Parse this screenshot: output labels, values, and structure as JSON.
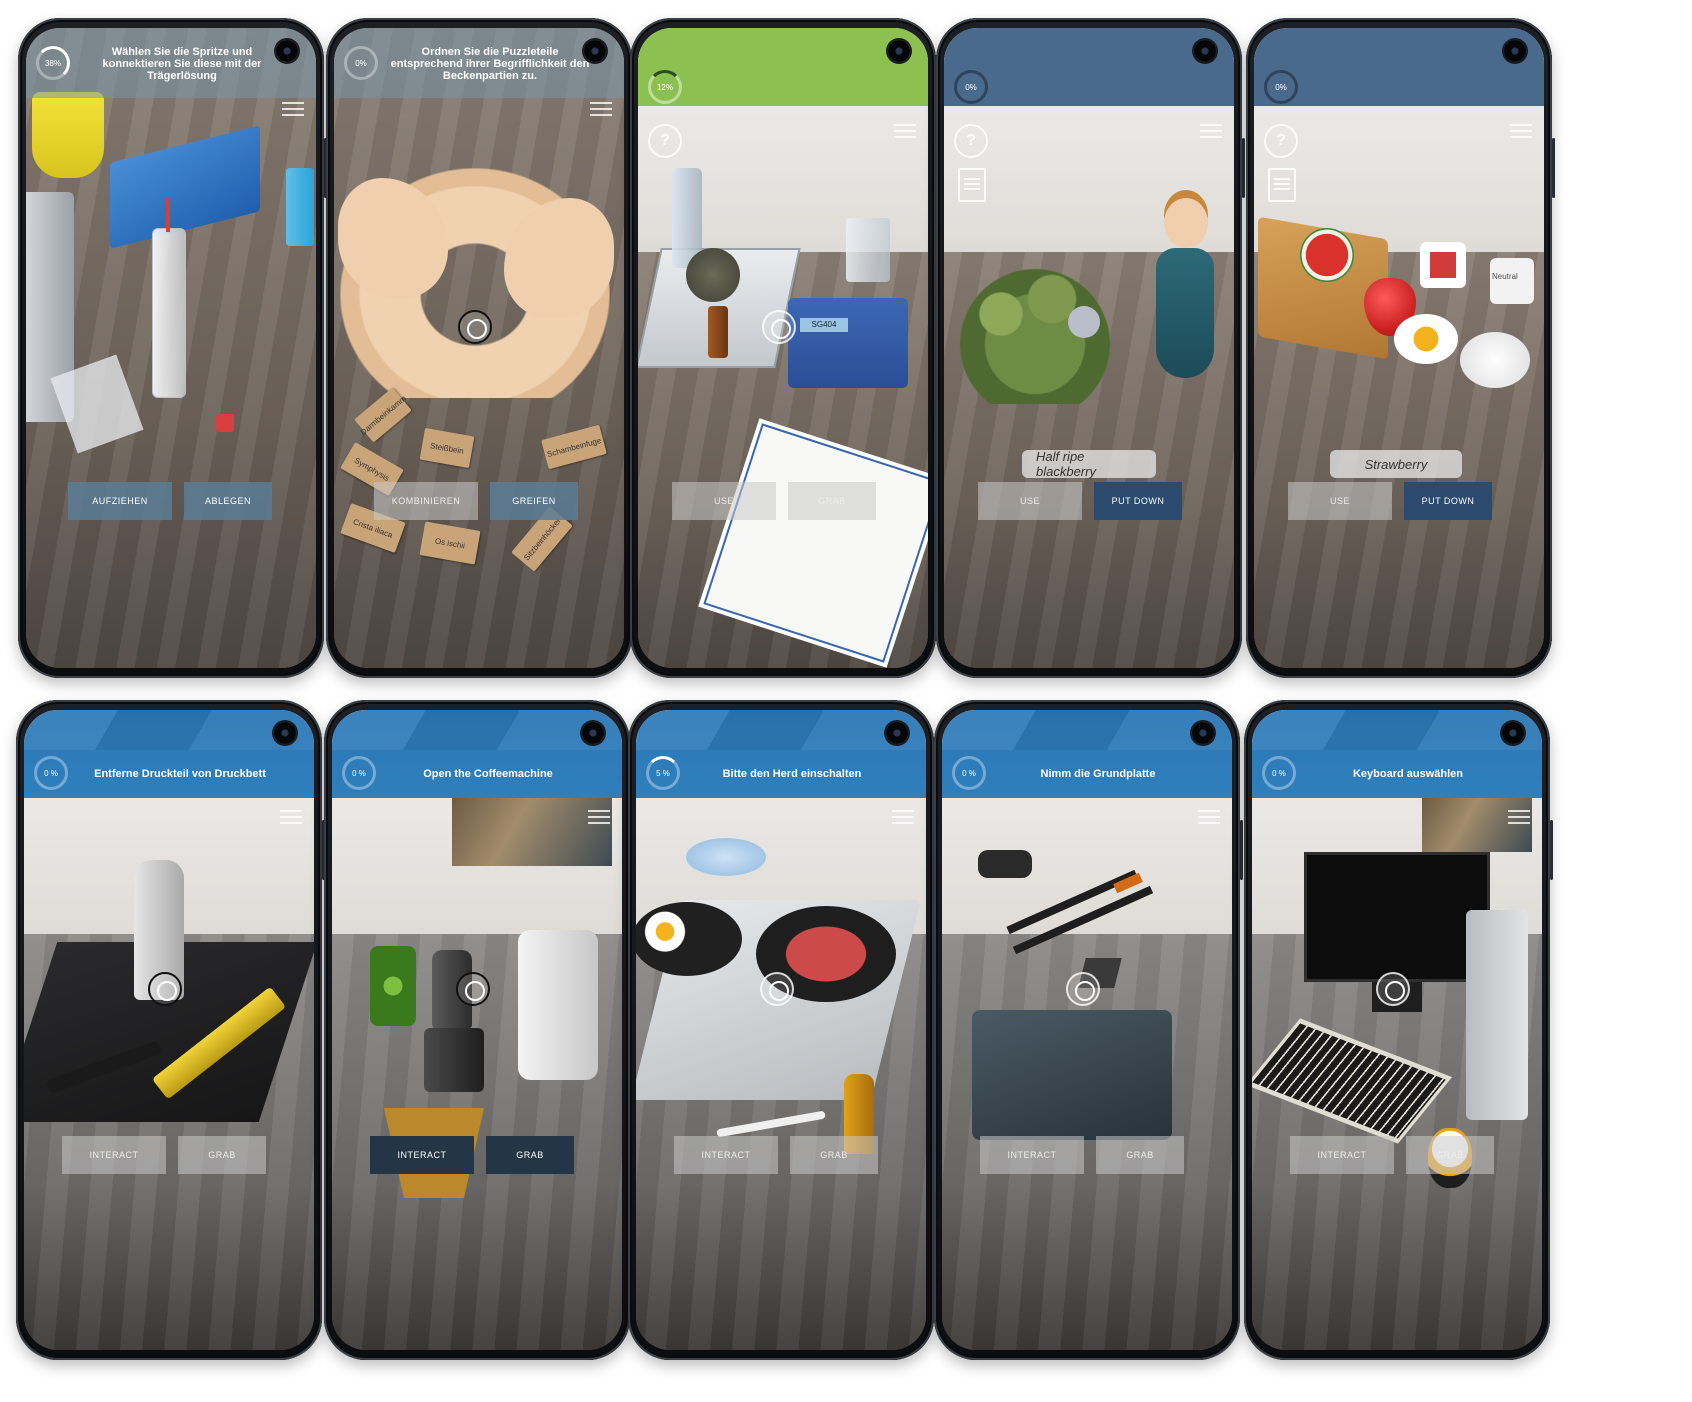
{
  "phones": [
    {
      "progress": "38%",
      "title": "Wählen Sie die Spritze und konnektieren Sie diese mit der Trägerlösung",
      "buttons": [
        "AUFZIEHEN",
        "ABLEGEN"
      ]
    },
    {
      "progress": "0%",
      "title": "Ordnen Sie die Puzzleteile entsprechend ihrer Begrifflichkeit den Beckenpartien zu.",
      "buttons": [
        "KOMBINIEREN",
        "GREIFEN"
      ],
      "puzzle_labels": [
        "Symphysis",
        "Crista iliaca",
        "Os ischii",
        "Sitzbeinhöcker",
        "Steißbein",
        "Kreuzbein",
        "Schambeinfuge",
        "Darmbeinkamm"
      ]
    },
    {
      "progress": "12%",
      "buttons": [
        "USE",
        "GRAB"
      ],
      "device_display": "SG404"
    },
    {
      "progress": "0%",
      "object_label": "Half ripe blackberry",
      "buttons": [
        "USE",
        "PUT DOWN"
      ]
    },
    {
      "progress": "0%",
      "object_label": "Strawberry",
      "buttons": [
        "USE",
        "PUT DOWN"
      ],
      "cube_label": "Neutral"
    },
    {
      "progress": "0 %",
      "title": "Entferne Druckteil von Druckbett",
      "buttons": [
        "INTERACT",
        "GRAB"
      ]
    },
    {
      "progress": "0 %",
      "title": "Open the Coffeemachine",
      "buttons": [
        "INTERACT",
        "GRAB"
      ]
    },
    {
      "progress": "5 %",
      "title": "Bitte den Herd einschalten",
      "buttons": [
        "INTERACT",
        "GRAB"
      ]
    },
    {
      "progress": "0 %",
      "title": "Nimm die Grundplatte",
      "buttons": [
        "INTERACT",
        "GRAB"
      ]
    },
    {
      "progress": "0 %",
      "title": "Keyboard auswählen",
      "buttons": [
        "INTERACT",
        "GRAB"
      ]
    }
  ],
  "icons": {
    "camera": "front-camera-icon",
    "menu": "hamburger-menu-icon",
    "help": "help-icon",
    "document": "document-icon",
    "reticle": "crosshair-reticle-icon"
  },
  "help_glyph": "?",
  "colors": {
    "blue_header": "#2f7fbd",
    "green_header": "#8cc152",
    "navy_header": "#4a6a8d",
    "button_steel": "#5a7d96",
    "button_navy": "#2b4a6e"
  }
}
